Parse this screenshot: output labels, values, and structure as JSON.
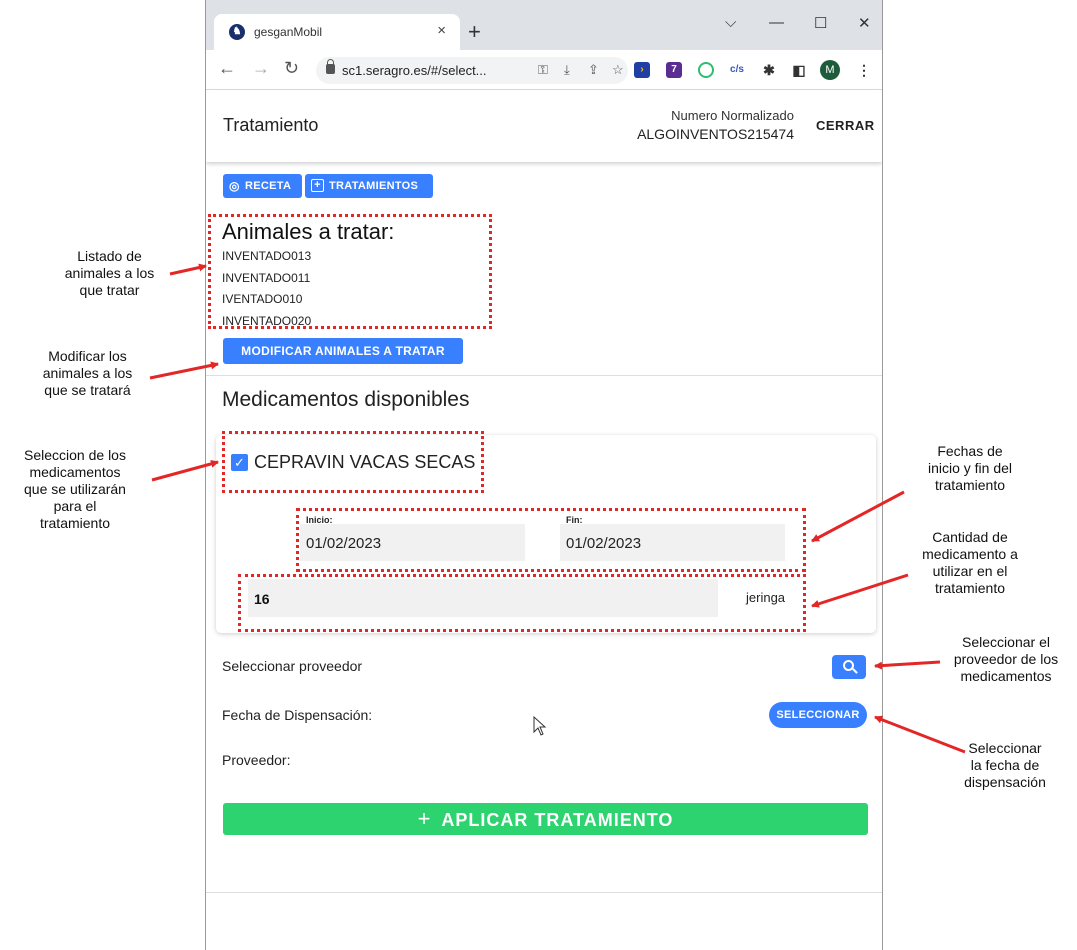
{
  "browser": {
    "tab_title": "gesganMobil",
    "tab_close": "×",
    "new_tab": "+",
    "url": "sc1.seragro.es/#/select...",
    "avatar_letter": "M",
    "ext_badge": "7",
    "ext_text": "c/s"
  },
  "header": {
    "title": "Tratamiento",
    "normalized_label": "Numero Normalizado",
    "normalized_value": "ALGOINVENTOS215474",
    "close_label": "CERRAR"
  },
  "actions": {
    "receta_label": "RECETA",
    "tratamientos_label": "TRATAMIENTOS"
  },
  "animals": {
    "heading": "Animales a tratar:",
    "items": [
      "INVENTADO013",
      "INVENTADO011",
      "IVENTADO010",
      "INVENTADO020"
    ],
    "modify_label": "MODIFICAR ANIMALES A TRATAR"
  },
  "medications": {
    "heading": "Medicamentos disponibles",
    "item": {
      "name": "CEPRAVIN VACAS SECAS",
      "checked": true,
      "start_label": "Inicio:",
      "start_value": "01/02/2023",
      "end_label": "Fin:",
      "end_value": "01/02/2023",
      "quantity": "16",
      "unit": "jeringa"
    }
  },
  "form": {
    "provider_select_label": "Seleccionar proveedor",
    "dispense_date_label": "Fecha de Dispensación:",
    "select_button_label": "SELECCIONAR",
    "provider_label": "Proveedor:",
    "apply_button_label": "APLICAR TRATAMIENTO"
  },
  "annotations": {
    "animal_list": [
      "Listado de",
      "animales a los",
      "que tratar"
    ],
    "modify_animals": [
      "Modificar los",
      "animales a los",
      "que se tratará"
    ],
    "select_meds": [
      "Seleccion de los",
      "medicamentos",
      "que se utilizarán",
      "para el",
      "tratamiento"
    ],
    "dates": [
      "Fechas de",
      "inicio y fin del",
      "tratamiento"
    ],
    "quantity": [
      "Cantidad de",
      "medicamento a",
      "utilizar en el",
      "tratamiento"
    ],
    "provider": [
      "Seleccionar el",
      "proveedor de los",
      "medicamentos"
    ],
    "dispense_date": [
      "Seleccionar",
      "la fecha de",
      "dispensación"
    ]
  },
  "colors": {
    "primary": "#3880ff",
    "success": "#2dd36f",
    "annotation": "#e32626"
  }
}
